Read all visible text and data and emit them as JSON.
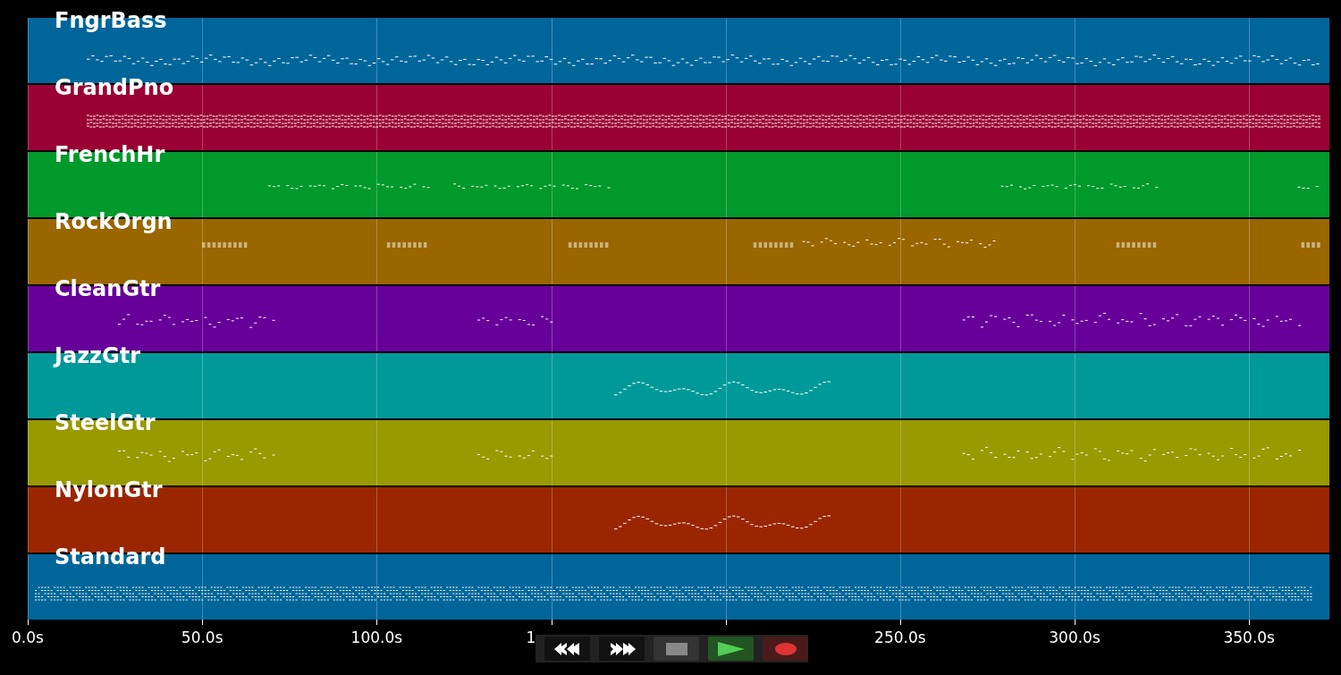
{
  "tracks": [
    {
      "name": "FngrBass",
      "color": "#00669a"
    },
    {
      "name": "GrandPno",
      "color": "#990033"
    },
    {
      "name": "FrenchHr",
      "color": "#00992c"
    },
    {
      "name": "RockOrgn",
      "color": "#996600"
    },
    {
      "name": "CleanGtr",
      "color": "#660099"
    },
    {
      "name": "JazzGtr",
      "color": "#009999"
    },
    {
      "name": "SteelGtr",
      "color": "#999900"
    },
    {
      "name": "NylonGtr",
      "color": "#992600"
    },
    {
      "name": "Standard",
      "color": "#00669a"
    }
  ],
  "time_axis": {
    "left_ticks": [
      "0.0s",
      "50.0s",
      "100.0s",
      "1"
    ],
    "right_ticks": [
      "250.0s",
      "300.0s",
      "350.0s"
    ]
  },
  "transport": {
    "buttons": [
      {
        "kind": "rewind"
      },
      {
        "kind": "forward"
      },
      {
        "kind": "stop"
      },
      {
        "kind": "play"
      },
      {
        "kind": "record"
      }
    ]
  }
}
